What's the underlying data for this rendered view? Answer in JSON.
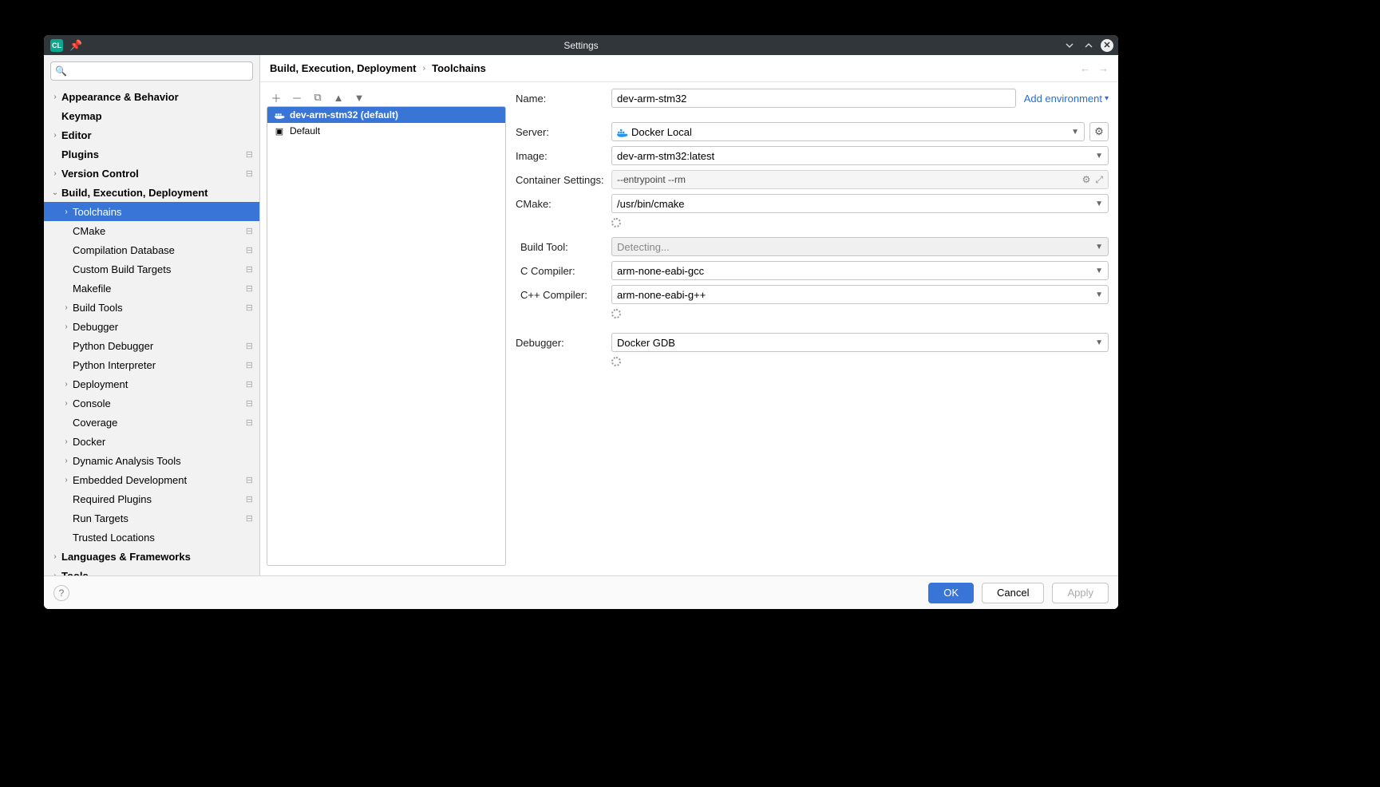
{
  "titlebar": {
    "title": "Settings"
  },
  "search": {
    "placeholder": ""
  },
  "tree": {
    "items": [
      {
        "label": "Appearance & Behavior",
        "depth": 1,
        "bold": true,
        "arrow": ">"
      },
      {
        "label": "Keymap",
        "depth": 1,
        "bold": true,
        "arrow": ""
      },
      {
        "label": "Editor",
        "depth": 1,
        "bold": true,
        "arrow": ">"
      },
      {
        "label": "Plugins",
        "depth": 1,
        "bold": true,
        "arrow": "",
        "extra": "⊟"
      },
      {
        "label": "Version Control",
        "depth": 1,
        "bold": true,
        "arrow": ">",
        "extra": "⊟"
      },
      {
        "label": "Build, Execution, Deployment",
        "depth": 1,
        "bold": true,
        "arrow": "v"
      },
      {
        "label": "Toolchains",
        "depth": 2,
        "selected": true,
        "arrow": ">"
      },
      {
        "label": "CMake",
        "depth": 2,
        "arrow": "",
        "extra": "⊟"
      },
      {
        "label": "Compilation Database",
        "depth": 2,
        "arrow": "",
        "extra": "⊟"
      },
      {
        "label": "Custom Build Targets",
        "depth": 2,
        "arrow": "",
        "extra": "⊟"
      },
      {
        "label": "Makefile",
        "depth": 2,
        "arrow": "",
        "extra": "⊟"
      },
      {
        "label": "Build Tools",
        "depth": 2,
        "arrow": ">",
        "extra": "⊟"
      },
      {
        "label": "Debugger",
        "depth": 2,
        "arrow": ">"
      },
      {
        "label": "Python Debugger",
        "depth": 2,
        "arrow": "",
        "extra": "⊟"
      },
      {
        "label": "Python Interpreter",
        "depth": 2,
        "arrow": "",
        "extra": "⊟"
      },
      {
        "label": "Deployment",
        "depth": 2,
        "arrow": ">",
        "extra": "⊟"
      },
      {
        "label": "Console",
        "depth": 2,
        "arrow": ">",
        "extra": "⊟"
      },
      {
        "label": "Coverage",
        "depth": 2,
        "arrow": "",
        "extra": "⊟"
      },
      {
        "label": "Docker",
        "depth": 2,
        "arrow": ">"
      },
      {
        "label": "Dynamic Analysis Tools",
        "depth": 2,
        "arrow": ">"
      },
      {
        "label": "Embedded Development",
        "depth": 2,
        "arrow": ">",
        "extra": "⊟"
      },
      {
        "label": "Required Plugins",
        "depth": 2,
        "arrow": "",
        "extra": "⊟"
      },
      {
        "label": "Run Targets",
        "depth": 2,
        "arrow": "",
        "extra": "⊟"
      },
      {
        "label": "Trusted Locations",
        "depth": 2,
        "arrow": ""
      },
      {
        "label": "Languages & Frameworks",
        "depth": 1,
        "bold": true,
        "arrow": ">"
      },
      {
        "label": "Tools",
        "depth": 1,
        "bold": true,
        "arrow": ">"
      }
    ]
  },
  "breadcrumb": {
    "a": "Build, Execution, Deployment",
    "b": "Toolchains"
  },
  "toolchain_list": {
    "items": [
      {
        "label": "dev-arm-stm32 (default)",
        "selected": true,
        "icon": "docker"
      },
      {
        "label": "Default",
        "icon": "terminal"
      }
    ]
  },
  "form": {
    "name_label": "Name:",
    "name_value": "dev-arm-stm32",
    "add_env_label": "Add environment",
    "server_label": "Server:",
    "server_value": "Docker Local",
    "image_label": "Image:",
    "image_value": "dev-arm-stm32:latest",
    "container_label": "Container Settings:",
    "container_value": "--entrypoint --rm",
    "cmake_label": "CMake:",
    "cmake_value": "/usr/bin/cmake",
    "buildtool_label": "Build Tool:",
    "buildtool_value": "Detecting...",
    "cc_label": "C Compiler:",
    "cc_value": "arm-none-eabi-gcc",
    "cxx_label": "C++ Compiler:",
    "cxx_value": "arm-none-eabi-g++",
    "debugger_label": "Debugger:",
    "debugger_value": "Docker GDB"
  },
  "footer": {
    "ok": "OK",
    "cancel": "Cancel",
    "apply": "Apply"
  }
}
